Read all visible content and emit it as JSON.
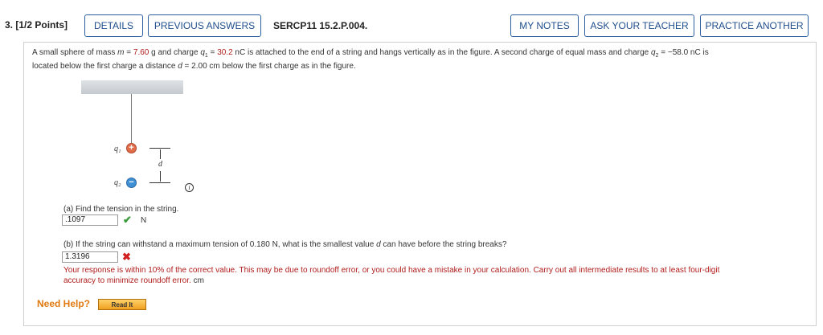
{
  "header": {
    "question_number": "3.",
    "points": "[1/2 Points]",
    "details_label": "DETAILS",
    "previous_answers_label": "PREVIOUS ANSWERS",
    "problem_code": "SERCP11 15.2.P.004.",
    "my_notes_label": "MY NOTES",
    "ask_teacher_label": "ASK YOUR TEACHER",
    "practice_another_label": "PRACTICE ANOTHER"
  },
  "problem": {
    "text_1": "A small sphere of mass ",
    "m_symbol": "m",
    "text_eq1": " = ",
    "mass_value": "7.60",
    "text_2": " g and charge ",
    "q1_symbol": "q",
    "q1_sub": "1",
    "text_eq2": " = ",
    "q1_value": "30.2",
    "text_3": " nC is attached to the end of a string and hangs vertically as in the figure. A second charge of equal mass and charge ",
    "q2_symbol": "q",
    "q2_sub": "2",
    "text_4": " = −58.0 nC is",
    "line2_a": "located below the first charge a distance ",
    "d_symbol": "d",
    "line2_b": " = 2.00 cm below the first charge as in the figure."
  },
  "figure": {
    "q1_label": "q₁",
    "q2_label": "q₂",
    "q1_sign": "+",
    "q2_sign": "−",
    "d_label": "d",
    "info_icon": "i"
  },
  "part_a": {
    "prompt": "(a) Find the tension in the string.",
    "answer": ".1097",
    "status_icon": "✔",
    "unit": "N"
  },
  "part_b": {
    "prompt_a": "(b) If the string can withstand a maximum tension of 0.180 N, what is the smallest value ",
    "d_symbol": "d",
    "prompt_b": " can have before the string breaks?",
    "answer": "1.3196",
    "status_icon": "✖",
    "feedback_line1": "Your response is within 10% of the correct value. This may be due to roundoff error, or you could have a mistake in your calculation. Carry out all intermediate results to at least four-digit",
    "feedback_line2": "accuracy to minimize roundoff error.",
    "unit": "cm"
  },
  "help": {
    "need_help_label": "Need Help?",
    "read_it_label": "Read It"
  }
}
